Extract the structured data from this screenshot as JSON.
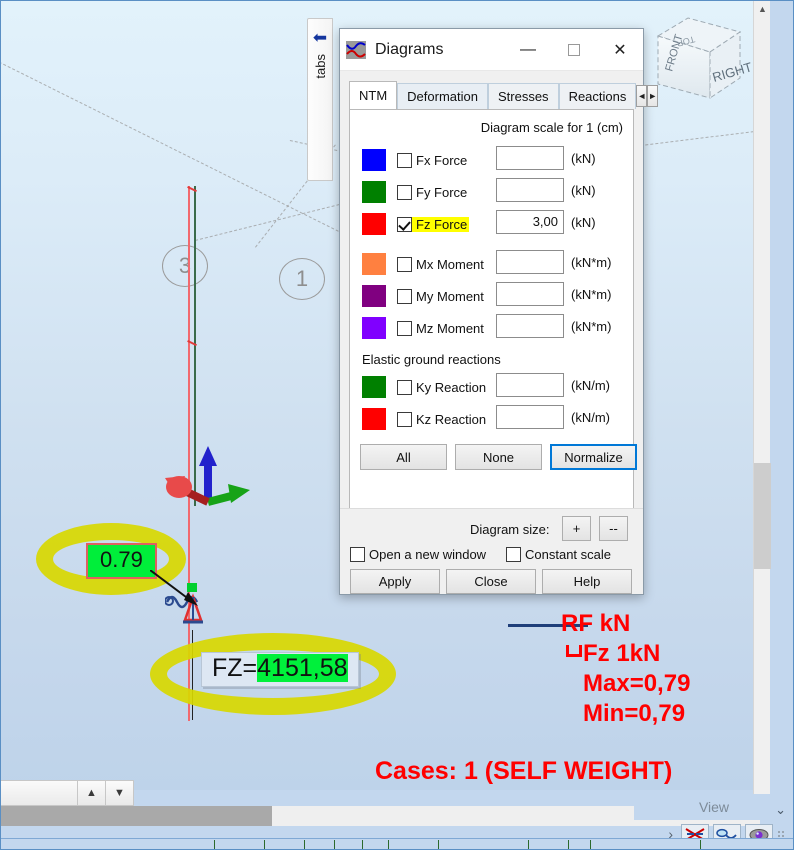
{
  "app": {
    "viewport_background": "#dcecf8",
    "view_label": "View",
    "grid_bubbles": [
      "3",
      "1"
    ]
  },
  "tabs_flyout": {
    "label": "tabs",
    "arrow_icon": "arrow-left-icon"
  },
  "viewcube": {
    "front": "FRONT",
    "right": "RIGHT",
    "top": "TOP"
  },
  "annotations": {
    "value_callout": "0.79",
    "fz_label": "FZ=",
    "fz_value": "4151,58",
    "highlight_color": "#d8d800",
    "value_bg": "#00ee3a"
  },
  "legend": {
    "rf_line": "RF kN",
    "fz_line": "Fz  1kN",
    "max": "Max=0,79",
    "min": "Min=0,79",
    "cases": "Cases: 1 (SELF WEIGHT)",
    "text_color": "#ff0000",
    "rule_color": "#1f3f7a"
  },
  "dialog": {
    "title": "Diagrams",
    "icon": "diagram-icon",
    "minimize": "—",
    "maximize": "□",
    "close": "✕",
    "tabs": [
      {
        "label": "NTM",
        "active": true
      },
      {
        "label": "Deformation",
        "active": false
      },
      {
        "label": "Stresses",
        "active": false
      },
      {
        "label": "Reactions",
        "active": false
      }
    ],
    "tab_scroll_left": "◄",
    "tab_scroll_right": "►",
    "scale_title": "Diagram scale for 1  (cm)",
    "force_rows": [
      {
        "color": "#0000ff",
        "label": "Fx Force",
        "checked": false,
        "value": "",
        "unit": "(kN)",
        "highlight": false
      },
      {
        "color": "#008000",
        "label": "Fy Force",
        "checked": false,
        "value": "",
        "unit": "(kN)",
        "highlight": false
      },
      {
        "color": "#ff0000",
        "label": "Fz Force",
        "checked": true,
        "value": "3,00",
        "unit": "(kN)",
        "highlight": true
      },
      {
        "color": "#ff8040",
        "label": "Mx Moment",
        "checked": false,
        "value": "",
        "unit": "(kN*m)",
        "highlight": false
      },
      {
        "color": "#800080",
        "label": "My Moment",
        "checked": false,
        "value": "",
        "unit": "(kN*m)",
        "highlight": false
      },
      {
        "color": "#8000ff",
        "label": "Mz Moment",
        "checked": false,
        "value": "",
        "unit": "(kN*m)",
        "highlight": false
      }
    ],
    "elastic_group_label": "Elastic ground reactions",
    "reaction_rows": [
      {
        "color": "#008000",
        "label": "Ky Reaction",
        "checked": false,
        "value": "",
        "unit": "(kN/m)"
      },
      {
        "color": "#ff0000",
        "label": "Kz Reaction",
        "checked": false,
        "value": "",
        "unit": "(kN/m)"
      }
    ],
    "select_buttons": [
      {
        "label": "All",
        "focus": false
      },
      {
        "label": "None",
        "focus": false
      },
      {
        "label": "Normalize",
        "focus": true
      }
    ],
    "diagram_size_label": "Diagram size:",
    "size_plus": "+",
    "size_minus": "--",
    "open_new_window": {
      "label": "Open a new window",
      "checked": false
    },
    "constant_scale": {
      "label": "Constant scale",
      "checked": false
    },
    "action_buttons": [
      {
        "label": "Apply"
      },
      {
        "label": "Close"
      },
      {
        "label": "Help"
      }
    ]
  },
  "statusbar": {
    "spin_up": "▲",
    "spin_down": "▼",
    "scroll_up": "▲",
    "scroll_down": "▼",
    "expand_chevron": "›",
    "view_chevron": "⌄",
    "icons": [
      "cut-section-icon",
      "link-icon",
      "render-view-icon"
    ]
  }
}
